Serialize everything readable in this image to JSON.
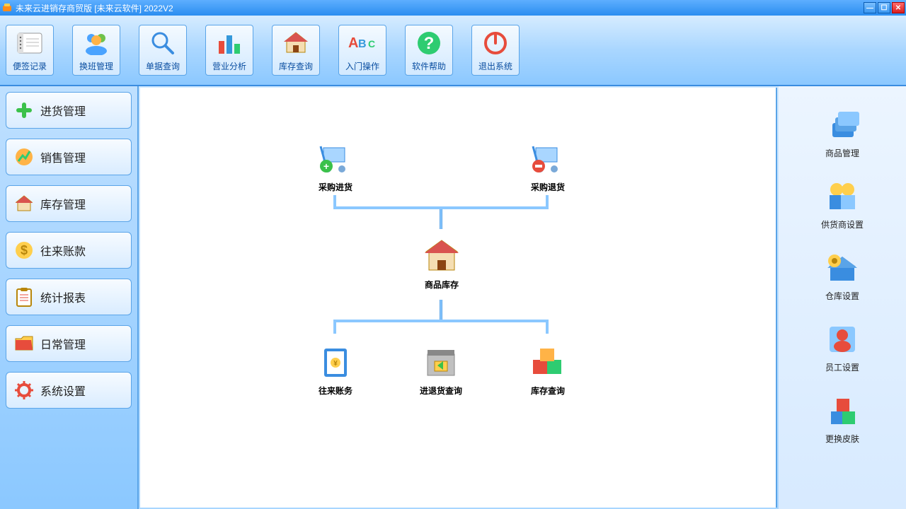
{
  "window": {
    "title": "未来云进销存商贸版 [未来云软件] 2022V2"
  },
  "toolbar": [
    {
      "key": "notes",
      "label": "便签记录"
    },
    {
      "key": "shift",
      "label": "换班管理"
    },
    {
      "key": "search",
      "label": "单据查询"
    },
    {
      "key": "analysis",
      "label": "营业分析"
    },
    {
      "key": "stock",
      "label": "库存查询"
    },
    {
      "key": "tutorial",
      "label": "入门操作"
    },
    {
      "key": "help",
      "label": "软件帮助"
    },
    {
      "key": "exit",
      "label": "退出系统"
    }
  ],
  "leftnav": [
    {
      "key": "purchase",
      "label": "进货管理"
    },
    {
      "key": "sales",
      "label": "销售管理"
    },
    {
      "key": "inventory",
      "label": "库存管理"
    },
    {
      "key": "accounts",
      "label": "往来账款"
    },
    {
      "key": "reports",
      "label": "统计报表"
    },
    {
      "key": "daily",
      "label": "日常管理"
    },
    {
      "key": "settings",
      "label": "系统设置"
    }
  ],
  "flow": {
    "purchase_in": "采购进货",
    "purchase_return": "采购退货",
    "goods_stock": "商品库存",
    "accounts": "往来账务",
    "inout_query": "进退货查询",
    "stock_query": "库存查询"
  },
  "shortcuts": [
    {
      "key": "goods",
      "label": "商品管理"
    },
    {
      "key": "supplier",
      "label": "供货商设置"
    },
    {
      "key": "warehouse",
      "label": "仓库设置"
    },
    {
      "key": "staff",
      "label": "员工设置"
    },
    {
      "key": "skin",
      "label": "更换皮肤"
    }
  ]
}
